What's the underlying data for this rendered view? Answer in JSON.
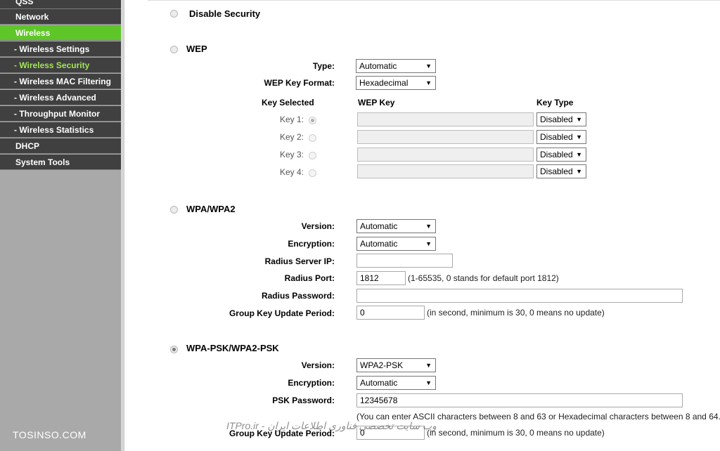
{
  "sidebar": {
    "items": [
      {
        "label": "QSS",
        "type": "main"
      },
      {
        "label": "Network",
        "type": "main"
      },
      {
        "label": "Wireless",
        "type": "main",
        "active": true
      },
      {
        "label": "- Wireless Settings",
        "type": "sub"
      },
      {
        "label": "- Wireless Security",
        "type": "sub",
        "active": true
      },
      {
        "label": "- Wireless MAC Filtering",
        "type": "sub"
      },
      {
        "label": "- Wireless Advanced",
        "type": "sub"
      },
      {
        "label": "- Throughput Monitor",
        "type": "sub"
      },
      {
        "label": "- Wireless Statistics",
        "type": "sub"
      },
      {
        "label": "DHCP",
        "type": "main"
      },
      {
        "label": "System Tools",
        "type": "main"
      }
    ]
  },
  "disable": {
    "title": "Disable Security"
  },
  "wep": {
    "title": "WEP",
    "type_label": "Type:",
    "type_value": "Automatic",
    "format_label": "WEP Key Format:",
    "format_value": "Hexadecimal",
    "col_key_selected": "Key Selected",
    "col_wep_key": "WEP Key",
    "col_key_type": "Key Type",
    "keys": [
      {
        "label": "Key 1:",
        "type": "Disabled"
      },
      {
        "label": "Key 2:",
        "type": "Disabled"
      },
      {
        "label": "Key 3:",
        "type": "Disabled"
      },
      {
        "label": "Key 4:",
        "type": "Disabled"
      }
    ]
  },
  "wpa": {
    "title": "WPA/WPA2",
    "version_label": "Version:",
    "version_value": "Automatic",
    "encryption_label": "Encryption:",
    "encryption_value": "Automatic",
    "radius_ip_label": "Radius Server IP:",
    "radius_ip_value": "",
    "radius_port_label": "Radius Port:",
    "radius_port_value": "1812",
    "radius_port_hint": "(1-65535, 0 stands for default port 1812)",
    "radius_pw_label": "Radius Password:",
    "radius_pw_value": "",
    "gkup_label": "Group Key Update Period:",
    "gkup_value": "0",
    "gkup_hint": "(in second, minimum is 30, 0 means no update)"
  },
  "psk": {
    "title": "WPA-PSK/WPA2-PSK",
    "version_label": "Version:",
    "version_value": "WPA2-PSK",
    "encryption_label": "Encryption:",
    "encryption_value": "Automatic",
    "password_label": "PSK Password:",
    "password_value": "12345678",
    "password_hint": "(You can enter ASCII characters between 8 and 63 or Hexadecimal characters between 8 and 64.)",
    "gkup_label": "Group Key Update Period:",
    "gkup_value": "0",
    "gkup_hint": "(in second, minimum is 30, 0 means no update)"
  },
  "watermarks": {
    "left": "TOSINSO.COM",
    "center": "ITPro.ir - وب سایت تخصصی فناوری اطلاعات ایران"
  },
  "colors": {
    "sidebar_bg": "#a9a9a9",
    "nav_bg": "#404040",
    "active_bg": "#5fc629",
    "active_sub_text": "#a2e35b"
  }
}
